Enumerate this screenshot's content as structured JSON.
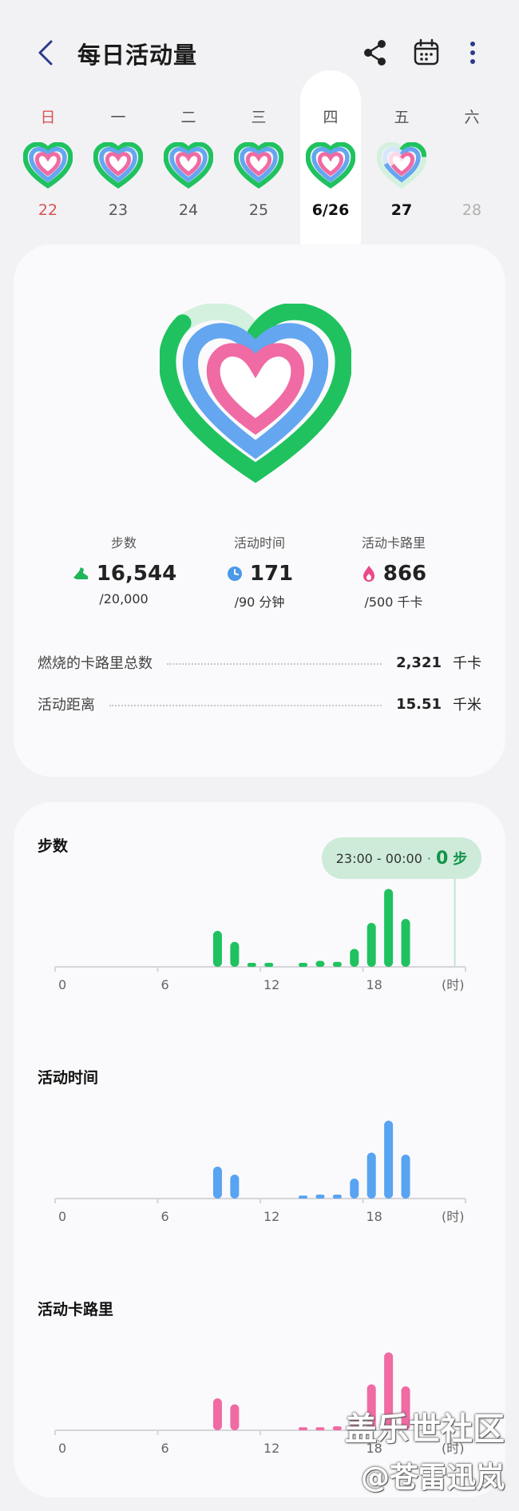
{
  "header": {
    "title": "每日活动量"
  },
  "week": [
    {
      "weekday": "日",
      "date": "22",
      "weekday_color": "#d9534f",
      "date_color": "#d9534f",
      "state": "complete"
    },
    {
      "weekday": "一",
      "date": "23",
      "state": "complete"
    },
    {
      "weekday": "二",
      "date": "24",
      "state": "complete"
    },
    {
      "weekday": "三",
      "date": "25",
      "state": "complete"
    },
    {
      "weekday": "四",
      "date": "6/26",
      "state": "complete",
      "selected": true
    },
    {
      "weekday": "五",
      "date": "27",
      "state": "partial",
      "date_color": "#111111"
    },
    {
      "weekday": "六",
      "date": "28",
      "state": "future",
      "date_color": "#b0b0b0"
    }
  ],
  "stats": {
    "steps": {
      "label": "步数",
      "value": "16,544",
      "goal": "/20,000",
      "icon": "shoe-icon",
      "color": "#1fb55a"
    },
    "active_time": {
      "label": "活动时间",
      "value": "171",
      "goal": "/90 分钟",
      "icon": "clock-icon",
      "color": "#4b9ae8"
    },
    "active_calories": {
      "label": "活动卡路里",
      "value": "866",
      "goal": "/500 千卡",
      "icon": "flame-icon",
      "color": "#e94b8a"
    }
  },
  "details": {
    "total_calories": {
      "label": "燃烧的卡路里总数",
      "value": "2,321",
      "unit": "千卡"
    },
    "distance": {
      "label": "活动距离",
      "value": "15.51",
      "unit": "千米"
    }
  },
  "tooltip": {
    "range": "23:00 - 00:00",
    "value": "0",
    "unit": "步"
  },
  "chart_data": [
    {
      "type": "bar",
      "title": "步数",
      "color": "#1fc25f",
      "x": [
        9,
        10,
        11,
        12,
        14,
        15,
        16,
        17,
        18,
        19,
        20
      ],
      "values": [
        36,
        25,
        4,
        4,
        4,
        6,
        5,
        18,
        44,
        78,
        48
      ],
      "xlim": [
        0,
        23
      ],
      "xticks": [
        "0",
        "6",
        "12",
        "18"
      ],
      "xunit": "(时)",
      "ymax": 80
    },
    {
      "type": "bar",
      "title": "活动时间",
      "color": "#58a3f2",
      "x": [
        9,
        10,
        14,
        15,
        16,
        17,
        18,
        19,
        20
      ],
      "values": [
        32,
        24,
        3,
        4,
        4,
        20,
        46,
        78,
        44
      ],
      "xlim": [
        0,
        23
      ],
      "xticks": [
        "0",
        "6",
        "12",
        "18"
      ],
      "xunit": "(时)",
      "ymax": 80
    },
    {
      "type": "bar",
      "title": "活动卡路里",
      "color": "#f06aa3",
      "x": [
        9,
        10,
        14,
        15,
        16,
        17,
        18,
        19,
        20
      ],
      "values": [
        32,
        26,
        3,
        3,
        4,
        14,
        46,
        78,
        44
      ],
      "xlim": [
        0,
        23
      ],
      "xticks": [
        "0",
        "6",
        "12",
        "18"
      ],
      "xunit": "(时)",
      "ymax": 80
    }
  ],
  "watermark": {
    "line1": "盖乐世社区",
    "line2": "@苍雷迅岚"
  }
}
